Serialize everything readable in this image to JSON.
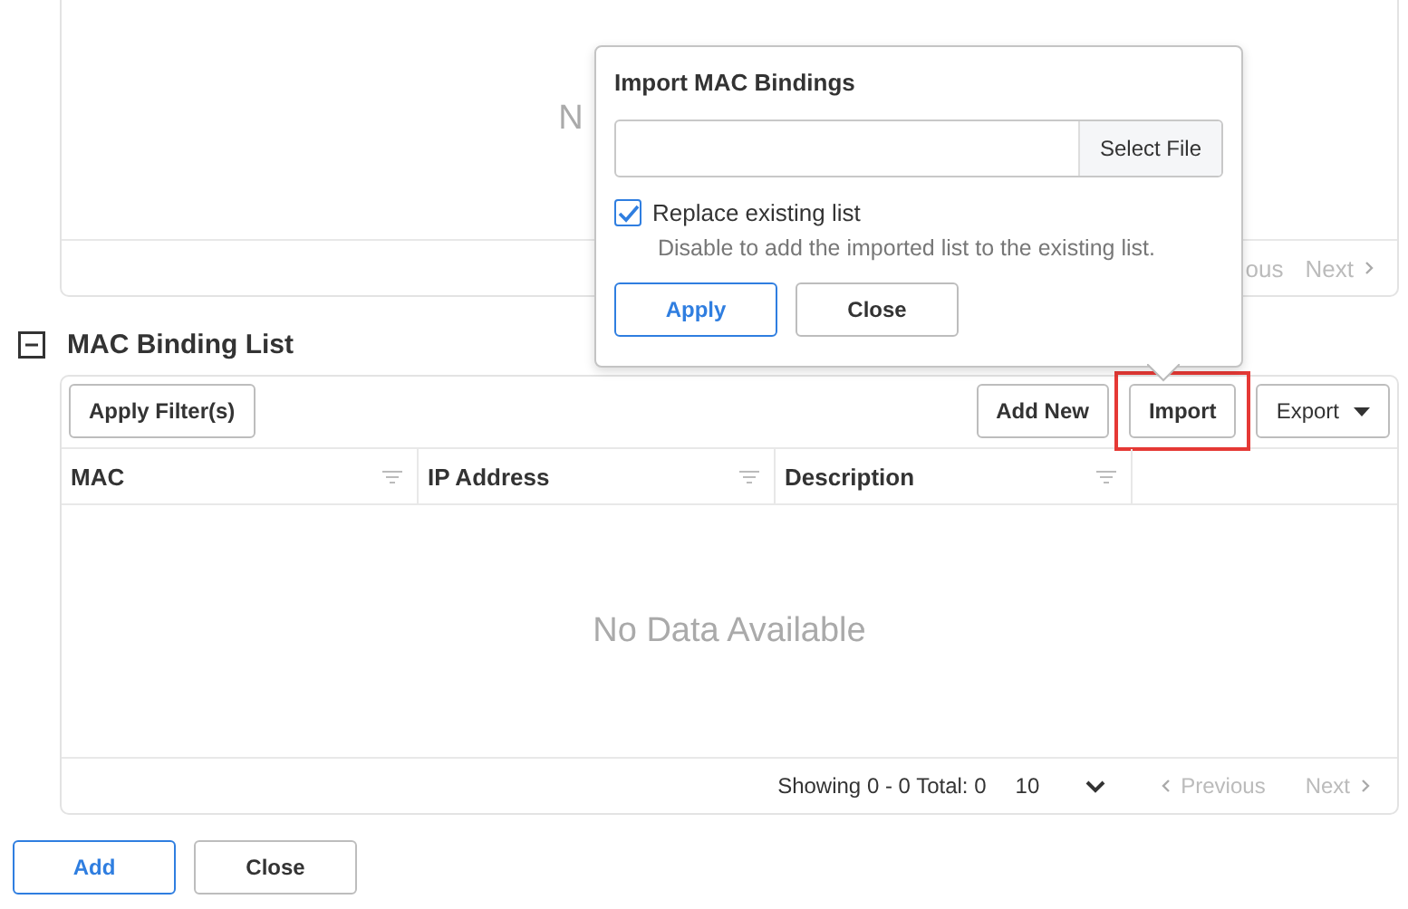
{
  "top_panel": {
    "empty_text": "N",
    "previous": "ous",
    "next": "Next"
  },
  "section": {
    "expanded": true,
    "title": "MAC Binding List"
  },
  "toolbar": {
    "filter_button": "Apply Filter(s)",
    "buttons": [
      {
        "label": "Add New",
        "kind": "button",
        "highlighted": false
      },
      {
        "label": "Import",
        "kind": "button",
        "highlighted": true
      },
      {
        "label": "Export",
        "kind": "dropdown",
        "highlighted": false
      }
    ]
  },
  "table": {
    "columns": [
      {
        "label": "MAC"
      },
      {
        "label": "IP Address"
      },
      {
        "label": "Description"
      }
    ],
    "empty_text": "No Data Available"
  },
  "footer": {
    "summary": "Showing 0 - 0 Total: 0",
    "page_size": "10",
    "previous": "Previous",
    "next": "Next"
  },
  "actions": [
    {
      "label": "Add",
      "primary": true
    },
    {
      "label": "Close",
      "primary": false
    }
  ],
  "popover": {
    "title": "Import MAC Bindings",
    "file_button": "Select File",
    "checkbox": {
      "label": "Replace existing list",
      "checked": true,
      "hint": "Disable to add the imported list to the existing list."
    },
    "buttons": [
      {
        "label": "Apply",
        "primary": true
      },
      {
        "label": "Close",
        "primary": false
      }
    ]
  }
}
